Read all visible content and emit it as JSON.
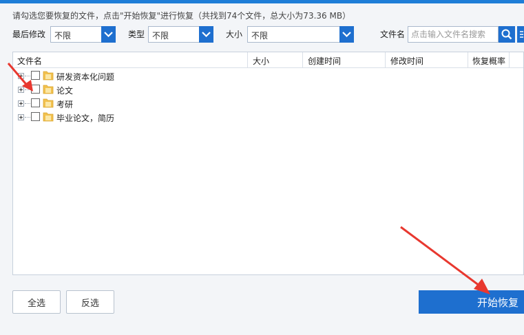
{
  "header": {
    "instruction": "请勾选您要恢复的文件，点击\"开始恢复\"进行恢复（共找到74个文件，总大小为73.36 MB）"
  },
  "filters": {
    "modified_label": "最后修改",
    "modified_value": "不限",
    "type_label": "类型",
    "type_value": "不限",
    "size_label": "大小",
    "size_value": "不限",
    "filename_label": "文件名",
    "search_placeholder": "点击输入文件名搜索"
  },
  "table": {
    "columns": [
      "文件名",
      "大小",
      "创建时间",
      "修改时间",
      "恢复概率"
    ],
    "rows": [
      {
        "name": "研发资本化问题"
      },
      {
        "name": "论文"
      },
      {
        "name": "考研"
      },
      {
        "name": "毕业论文，简历"
      }
    ]
  },
  "footer": {
    "select_all": "全选",
    "invert_select": "反选",
    "start_recover": "开始恢复"
  },
  "colors": {
    "accent": "#1e6fcf",
    "arrow": "#e8382f",
    "folder": "#f2c14e"
  },
  "icons": {
    "dropdown": "chevron-down-icon",
    "search": "search-icon",
    "folder": "folder-icon",
    "expand": "plus-box-icon"
  }
}
